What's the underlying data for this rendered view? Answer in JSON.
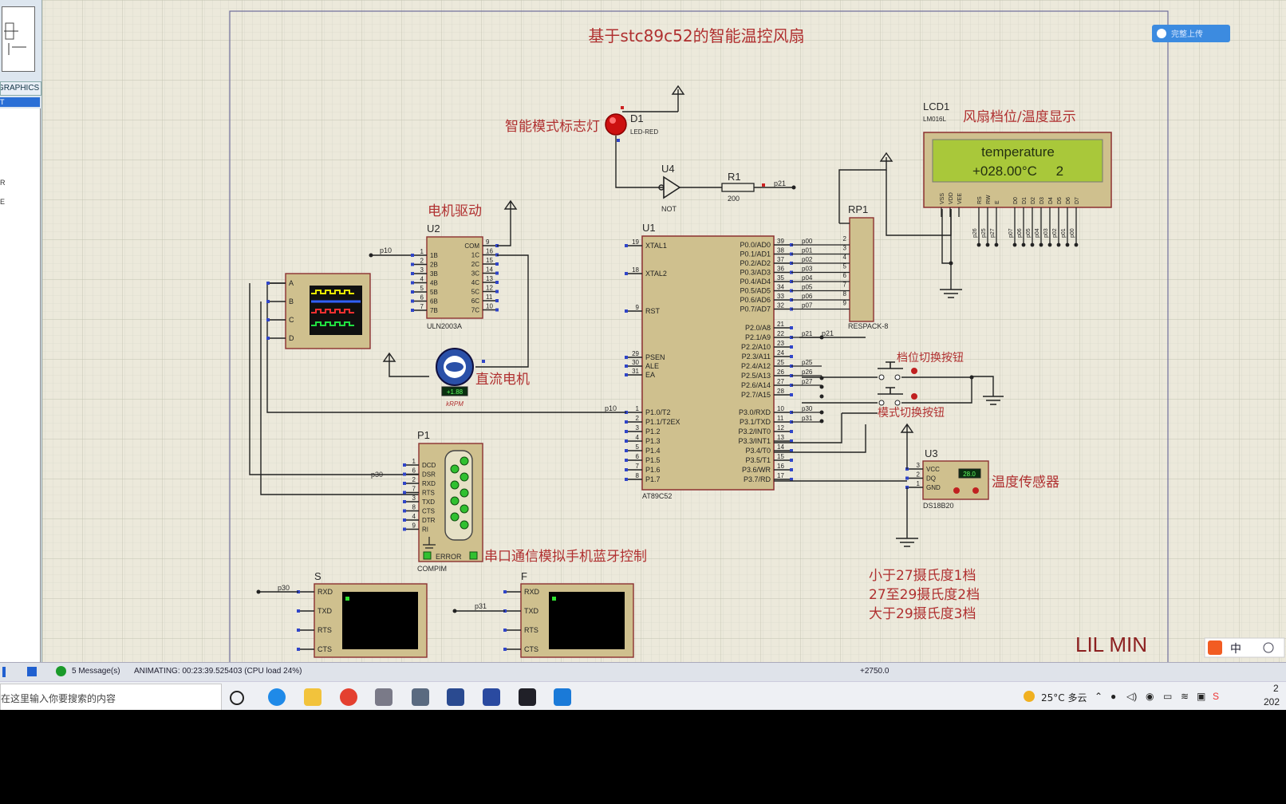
{
  "sidebar": {
    "tab_label": "GRAPHICS",
    "selected_label": "T",
    "items": [
      "R",
      "E"
    ]
  },
  "schematic": {
    "title": "基于stc89c52的智能温控风扇",
    "signature": "LIL MIN",
    "top_right_badge": "完整上传",
    "components": {
      "d1": {
        "ref": "D1",
        "type": "LED-RED",
        "caption": "智能模式标志灯"
      },
      "u4": {
        "ref": "U4",
        "type": "NOT"
      },
      "r1": {
        "ref": "R1",
        "value": "200",
        "net": "p21"
      },
      "lcd1": {
        "ref": "LCD1",
        "type": "LM016L",
        "caption": "风扇档位/温度显示",
        "line1": "temperature",
        "line2": "+028.00°C     2",
        "pins": [
          "VSS",
          "VDD",
          "VEE",
          "RS",
          "RW",
          "E",
          "D0",
          "D1",
          "D2",
          "D3",
          "D4",
          "D5",
          "D6",
          "D7"
        ],
        "pin_nets": [
          "p26",
          "p25",
          "p27",
          "p07",
          "p06",
          "p05",
          "p04",
          "p03",
          "p02",
          "p01",
          "p00"
        ]
      },
      "rp1": {
        "ref": "RP1",
        "type": "RESPACK-8",
        "pins": [
          "2",
          "3",
          "4",
          "5",
          "6",
          "7",
          "8",
          "9"
        ],
        "nets": [
          "p00",
          "p01",
          "p02",
          "p03",
          "p04",
          "p05",
          "p06",
          "p07"
        ]
      },
      "u2": {
        "ref": "U2",
        "type": "ULN2003A",
        "caption": "电机驱动",
        "net_in": "p10",
        "left_pins": [
          {
            "n": "1",
            "l": "1B"
          },
          {
            "n": "2",
            "l": "2B"
          },
          {
            "n": "3",
            "l": "3B"
          },
          {
            "n": "4",
            "l": "4B"
          },
          {
            "n": "5",
            "l": "5B"
          },
          {
            "n": "6",
            "l": "6B"
          },
          {
            "n": "7",
            "l": "7B"
          }
        ],
        "right_pins": [
          {
            "n": "9",
            "l": "COM"
          },
          {
            "n": "16",
            "l": "1C"
          },
          {
            "n": "15",
            "l": "2C"
          },
          {
            "n": "14",
            "l": "3C"
          },
          {
            "n": "13",
            "l": "4C"
          },
          {
            "n": "12",
            "l": "5C"
          },
          {
            "n": "11",
            "l": "6C"
          },
          {
            "n": "10",
            "l": "7C"
          }
        ]
      },
      "scope": {
        "pins": [
          "A",
          "B",
          "C",
          "D"
        ]
      },
      "motor": {
        "caption": "直流电机",
        "readout": "+1.88",
        "unit": "kRPM"
      },
      "u1": {
        "ref": "U1",
        "type": "AT89C52",
        "left_pins": [
          {
            "n": "19",
            "l": "XTAL1"
          },
          {
            "n": "18",
            "l": "XTAL2"
          },
          {
            "n": "9",
            "l": "RST"
          },
          {
            "n": "29",
            "l": "PSEN"
          },
          {
            "n": "30",
            "l": "ALE"
          },
          {
            "n": "31",
            "l": "EA"
          },
          {
            "n": "1",
            "l": "P1.0/T2"
          },
          {
            "n": "2",
            "l": "P1.1/T2EX"
          },
          {
            "n": "3",
            "l": "P1.2"
          },
          {
            "n": "4",
            "l": "P1.3"
          },
          {
            "n": "5",
            "l": "P1.4"
          },
          {
            "n": "6",
            "l": "P1.5"
          },
          {
            "n": "7",
            "l": "P1.6"
          },
          {
            "n": "8",
            "l": "P1.7"
          }
        ],
        "right_pins": [
          {
            "n": "39",
            "l": "P0.0/AD0",
            "net": "p00"
          },
          {
            "n": "38",
            "l": "P0.1/AD1",
            "net": "p01"
          },
          {
            "n": "37",
            "l": "P0.2/AD2",
            "net": "p02"
          },
          {
            "n": "36",
            "l": "P0.3/AD3",
            "net": "p03"
          },
          {
            "n": "35",
            "l": "P0.4/AD4",
            "net": "p04"
          },
          {
            "n": "34",
            "l": "P0.5/AD5",
            "net": "p05"
          },
          {
            "n": "33",
            "l": "P0.6/AD6",
            "net": "p06"
          },
          {
            "n": "32",
            "l": "P0.7/AD7",
            "net": "p07"
          },
          {
            "n": "21",
            "l": "P2.0/A8",
            "net": ""
          },
          {
            "n": "22",
            "l": "P2.1/A9",
            "net": "p21"
          },
          {
            "n": "23",
            "l": "P2.2/A10",
            "net": ""
          },
          {
            "n": "24",
            "l": "P2.3/A11",
            "net": ""
          },
          {
            "n": "25",
            "l": "P2.4/A12",
            "net": "p25"
          },
          {
            "n": "26",
            "l": "P2.5/A13",
            "net": "p26"
          },
          {
            "n": "27",
            "l": "P2.6/A14",
            "net": "p27"
          },
          {
            "n": "28",
            "l": "P2.7/A15",
            "net": ""
          },
          {
            "n": "10",
            "l": "P3.0/RXD",
            "net": "p30"
          },
          {
            "n": "11",
            "l": "P3.1/TXD",
            "net": "p31"
          },
          {
            "n": "12",
            "l": "P3.2/INT0",
            "net": ""
          },
          {
            "n": "13",
            "l": "P3.3/INT1",
            "net": ""
          },
          {
            "n": "14",
            "l": "P3.4/T0",
            "net": ""
          },
          {
            "n": "15",
            "l": "P3.5/T1",
            "net": ""
          },
          {
            "n": "16",
            "l": "P3.6/WR",
            "net": ""
          },
          {
            "n": "17",
            "l": "P3.7/RD",
            "net": ""
          }
        ],
        "net_p10": "p10",
        "net_p21": "p21"
      },
      "sw1": {
        "caption": "档位切换按钮"
      },
      "sw2": {
        "caption": "模式切换按钮"
      },
      "u3": {
        "ref": "U3",
        "type": "DS18B20",
        "caption": "温度传感器",
        "readout": "28.0",
        "pins": [
          {
            "n": "3",
            "l": "VCC"
          },
          {
            "n": "2",
            "l": "DQ"
          },
          {
            "n": "1",
            "l": "GND"
          }
        ]
      },
      "p1": {
        "ref": "P1",
        "type": "COMPIM",
        "caption": "串口通信模拟手机蓝牙控制",
        "error": "ERROR",
        "net": "p30",
        "pins": [
          {
            "n": "1",
            "l": "DCD"
          },
          {
            "n": "6",
            "l": "DSR"
          },
          {
            "n": "2",
            "l": "RXD"
          },
          {
            "n": "7",
            "l": "RTS"
          },
          {
            "n": "3",
            "l": "TXD"
          },
          {
            "n": "8",
            "l": "CTS"
          },
          {
            "n": "4",
            "l": "DTR"
          },
          {
            "n": "9",
            "l": "RI"
          }
        ]
      },
      "term_s": {
        "ref": "S",
        "net": "p30",
        "pins": [
          "RXD",
          "TXD",
          "RTS",
          "CTS"
        ]
      },
      "term_f": {
        "ref": "F",
        "net": "p31",
        "pins": [
          "RXD",
          "TXD",
          "RTS",
          "CTS"
        ]
      }
    },
    "notes": [
      "小于27摄氏度1档",
      "27至29摄氏度2档",
      "大于29摄氏度3档"
    ]
  },
  "statusbar": {
    "messages": "5 Message(s)",
    "animating": "ANIMATING: 00:23:39.525403 (CPU load 24%)",
    "coord": "+2750.0"
  },
  "taskbar": {
    "search_placeholder": "在这里输入你要搜索的内容",
    "weather": "25°C  多云",
    "clock_top": "2",
    "clock_bottom": "202"
  },
  "ime": {
    "label": "中"
  }
}
